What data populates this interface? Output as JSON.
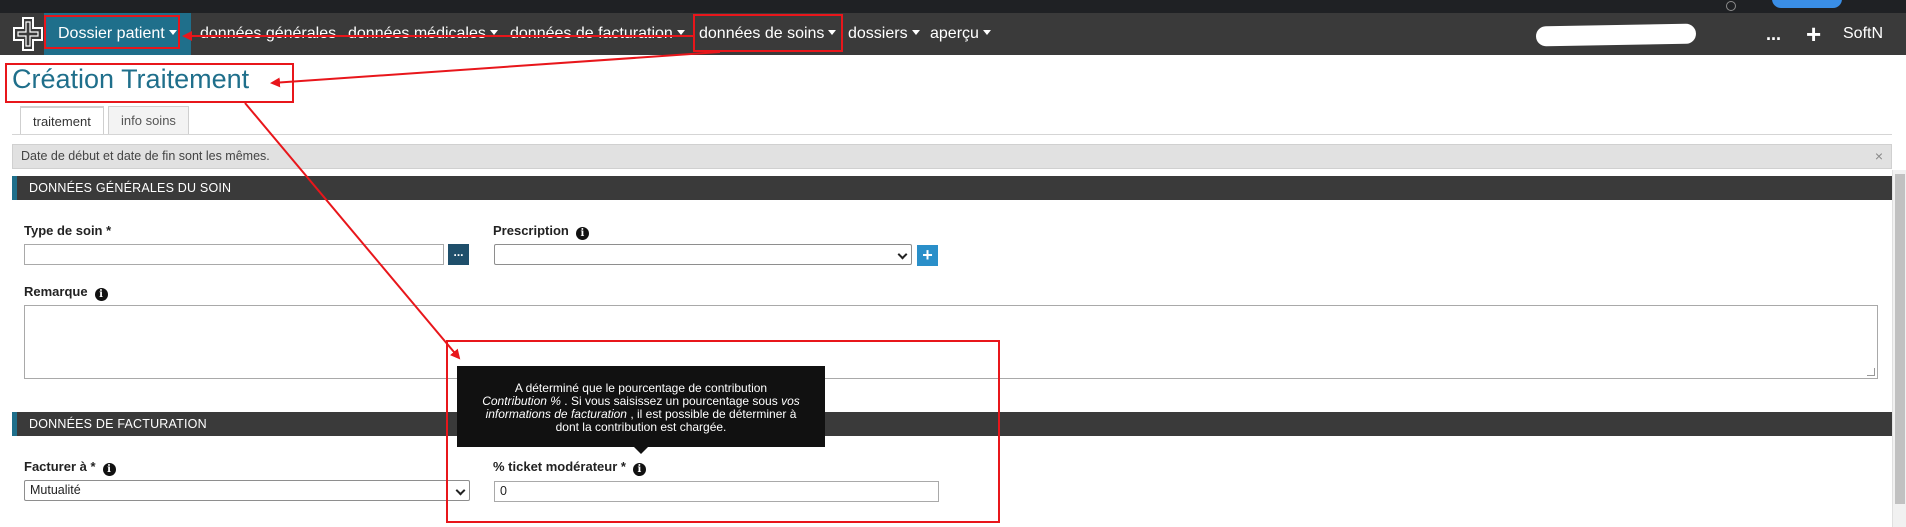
{
  "navbar": {
    "brand_label": "Dossier patient",
    "items": [
      {
        "label": "données générales"
      },
      {
        "label": "données médicales"
      },
      {
        "label": "données de facturation"
      },
      {
        "label": "données de soins"
      },
      {
        "label": "dossiers"
      },
      {
        "label": "aperçu"
      }
    ],
    "more_label": "...",
    "add_label": "+",
    "user_label": "SoftN"
  },
  "page": {
    "title": "Création Traitement"
  },
  "tabs": [
    {
      "label": "traitement",
      "active": true
    },
    {
      "label": "info soins",
      "active": false
    }
  ],
  "alert": {
    "message": "Date de début et date de fin sont les mêmes.",
    "close_label": "×"
  },
  "sections": {
    "general": {
      "title": "DONNÉES GÉNÉRALES DU SOIN",
      "type_soin_label": "Type de soin *",
      "type_soin_value": "",
      "browse_label": "...",
      "prescription_label": "Prescription",
      "prescription_value": "",
      "add_prescription_label": "+",
      "remarque_label": "Remarque"
    },
    "billing": {
      "title": "DONNÉES DE FACTURATION",
      "facturer_label": "Facturer à *",
      "facturer_value": "Mutualité",
      "ticket_label": "% ticket modérateur *",
      "ticket_value": "0"
    }
  },
  "tooltip": {
    "line1": "A déterminé que le pourcentage de contribution",
    "italic1": "Contribution %",
    "line2": ". Si vous saisissez un pourcentage sous",
    "italic2a": "vos",
    "italic2b": "informations de facturation",
    "line3": ", il est possible de déterminer à",
    "line4": "dont la contribution est chargée."
  },
  "colors": {
    "annotation": "#e8161b",
    "brand": "#1f6f8b",
    "navbar": "#3a3a3a"
  }
}
